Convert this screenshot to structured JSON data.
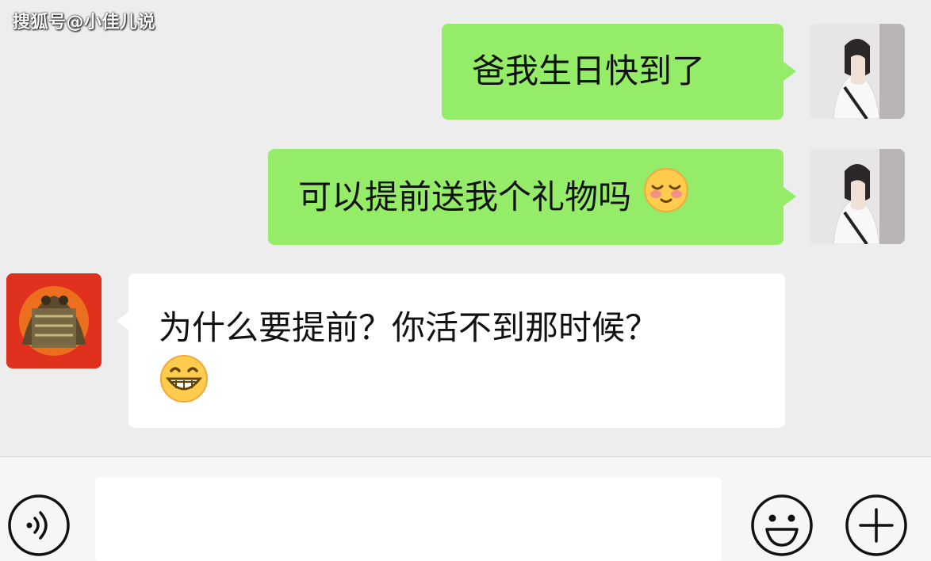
{
  "watermark": "搜狐号@小佳儿说",
  "messages": [
    {
      "sender": "me",
      "text": "爸我生日快到了",
      "emoji": null
    },
    {
      "sender": "me",
      "text": "可以提前送我个礼物吗",
      "emoji": "blushing-face-icon"
    },
    {
      "sender": "other",
      "text": "为什么要提前？你活不到那时候？",
      "emoji": "grinning-face-icon"
    }
  ],
  "input": {
    "value": "",
    "placeholder": ""
  },
  "toolbar": {
    "voice_icon": "voice-icon",
    "emoji_icon": "smiley-icon",
    "plus_icon": "plus-icon"
  },
  "colors": {
    "background": "#ededed",
    "my_bubble": "#95ec69",
    "their_bubble": "#ffffff",
    "input_bar": "#f6f6f6"
  }
}
